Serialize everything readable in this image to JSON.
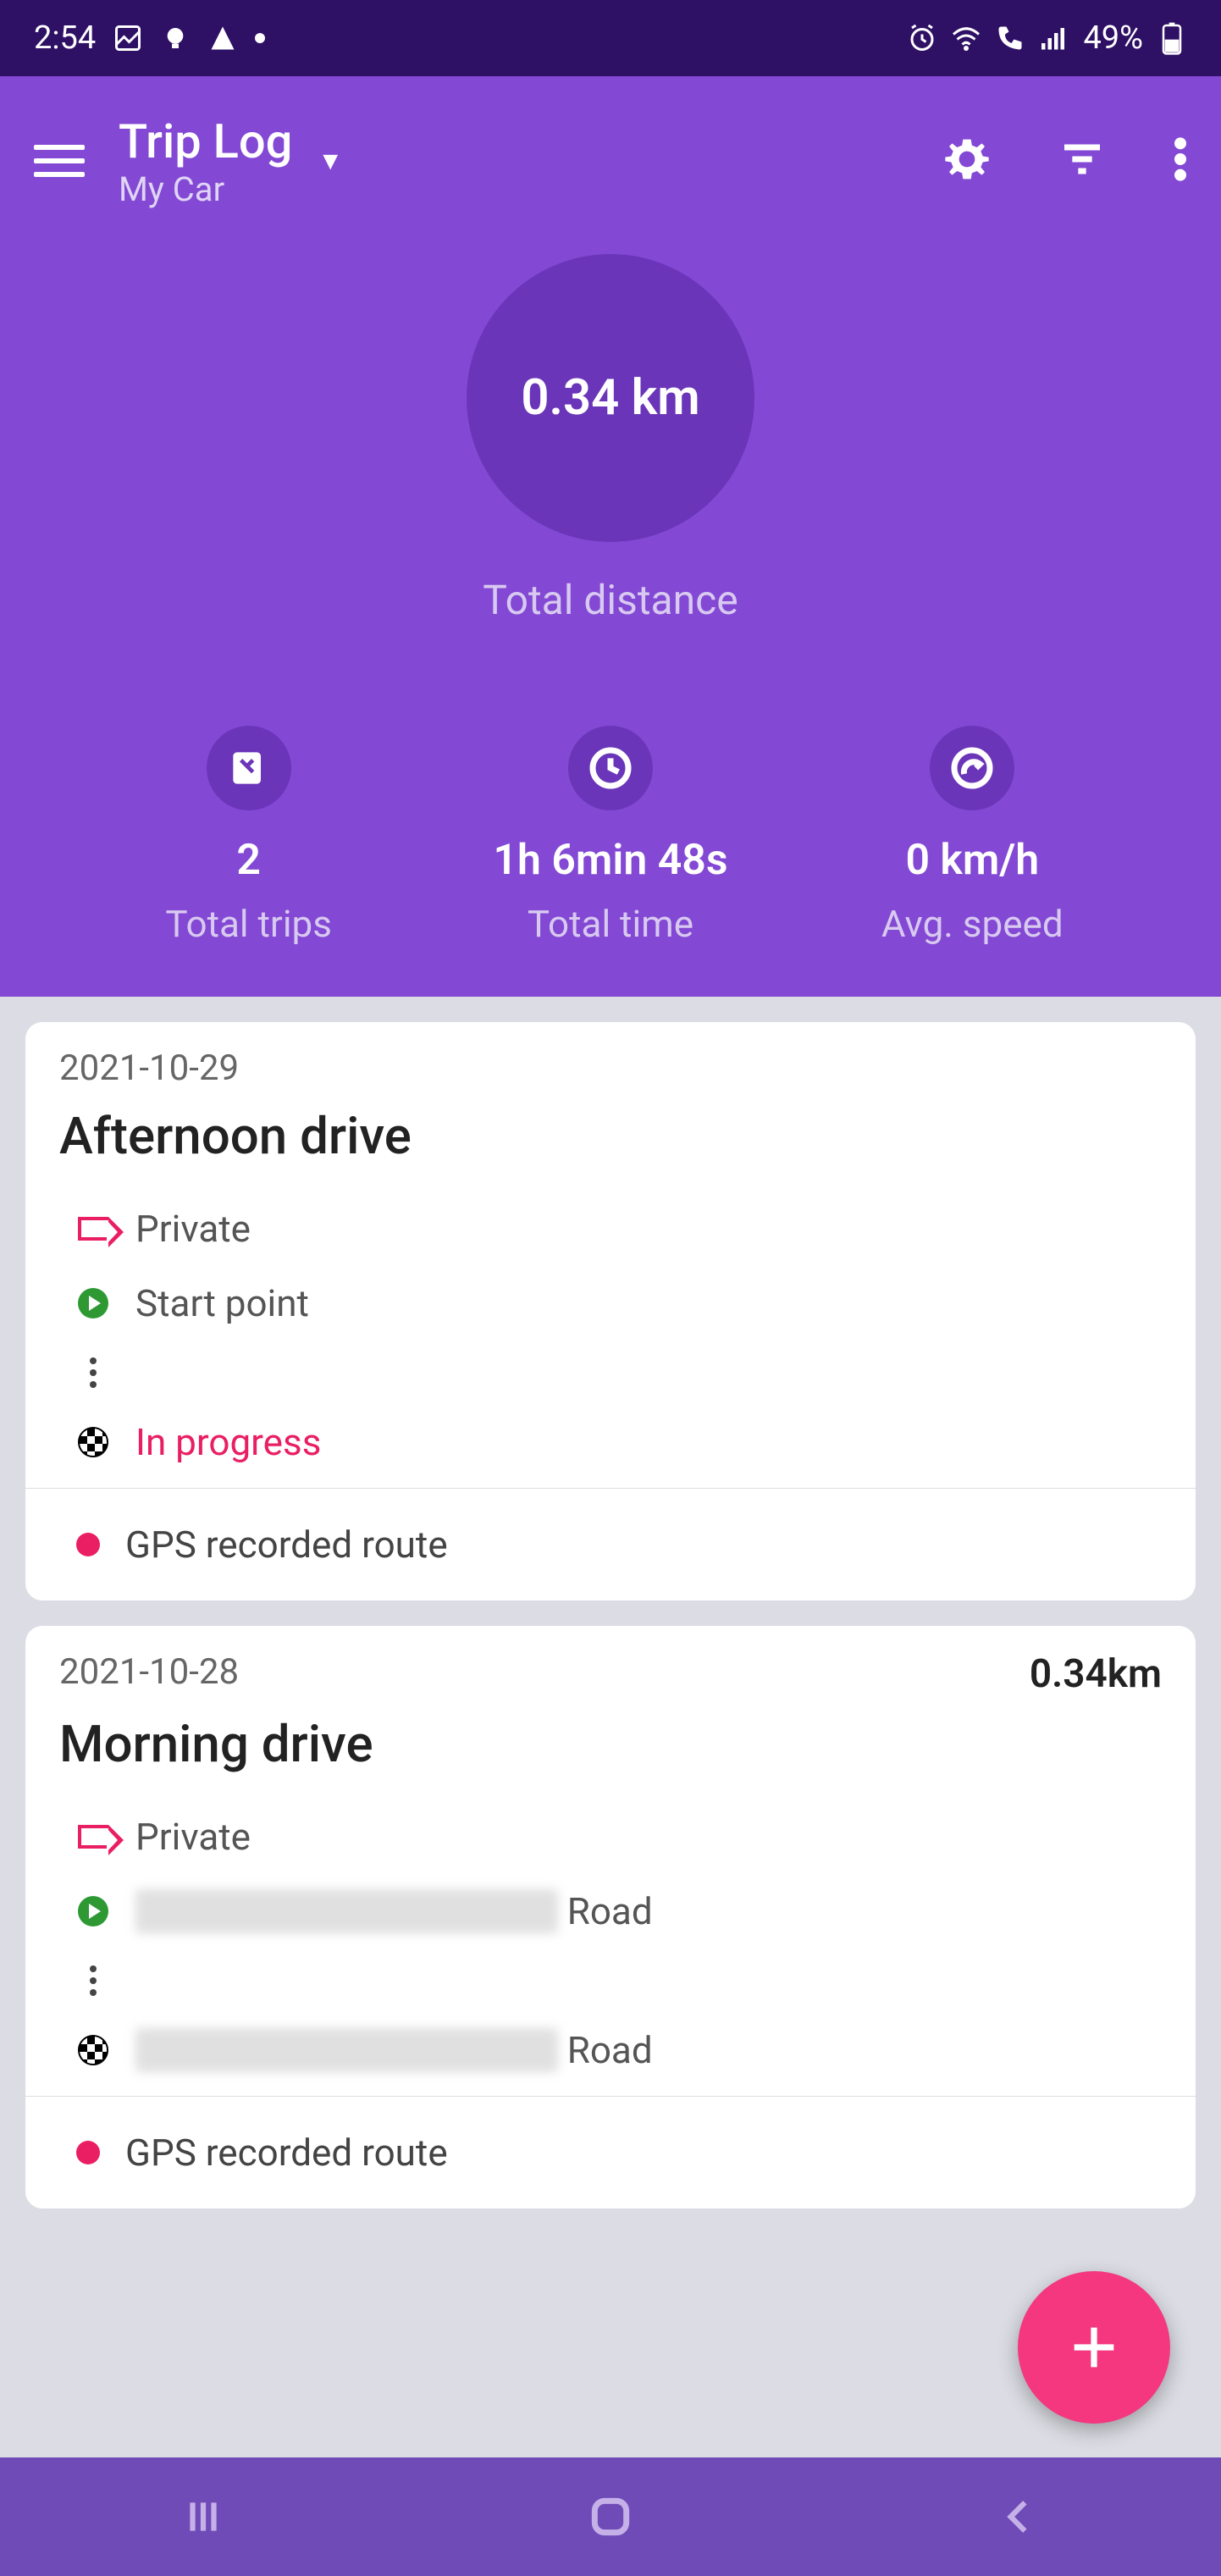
{
  "status": {
    "time": "2:54",
    "battery": "49%"
  },
  "header": {
    "title": "Trip Log",
    "subtitle": "My Car"
  },
  "hero": {
    "value": "0.34 km",
    "label": "Total distance"
  },
  "stats": {
    "trips": {
      "value": "2",
      "label": "Total trips"
    },
    "time": {
      "value": "1h 6min 48s",
      "label": "Total time"
    },
    "speed": {
      "value": "0 km/h",
      "label": "Avg. speed"
    }
  },
  "trips": [
    {
      "date": "2021-10-29",
      "distance": "",
      "title": "Afternoon drive",
      "tag": "Private",
      "start": "Start point",
      "end": "In progress",
      "end_style": "pink",
      "gps": "GPS recorded route"
    },
    {
      "date": "2021-10-28",
      "distance": "0.34km",
      "title": "Morning drive",
      "tag": "Private",
      "start_blur": "████████████████",
      "start_suffix": " Road",
      "end_blur": "████████████████",
      "end_suffix": " Road",
      "gps": "GPS recorded route"
    }
  ]
}
